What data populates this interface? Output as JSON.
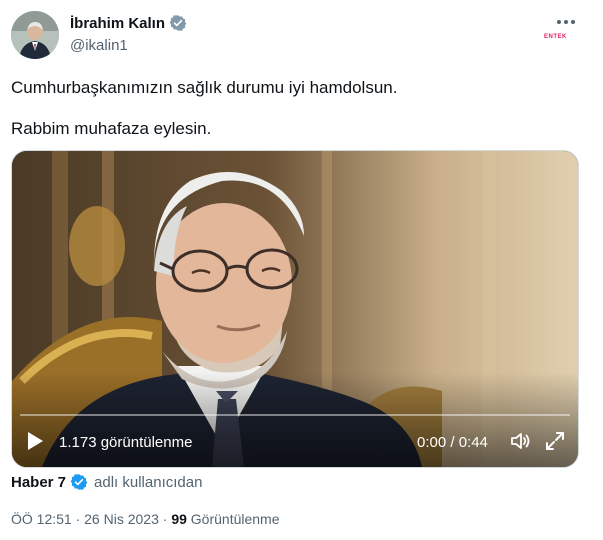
{
  "author": {
    "name": "İbrahim Kalın",
    "handle": "@ikalin1"
  },
  "watermark": "ENTEK",
  "more_icon": "more-horizontal-icon",
  "tweet": {
    "line1": "Cumhurbaşkanımızın sağlık durumu iyi hamdolsun.",
    "line2": "Rabbim muhafaza eylesin."
  },
  "video": {
    "views_overlay": "1.173 görüntülenme",
    "time": "0:00 / 0:44",
    "progress": 0
  },
  "source": {
    "name": "Haber 7",
    "from_text": "adlı kullanıcıdan"
  },
  "meta": {
    "time_prefix": "ÖÖ 12:51 · 26 Nis 2023 · ",
    "views_count": "99",
    "views_label": " Görüntülenme"
  },
  "colors": {
    "verified_blue": "#1d9bf0",
    "verified_gray": "#829aab",
    "text_primary": "#0f1419",
    "text_secondary": "#536471"
  }
}
